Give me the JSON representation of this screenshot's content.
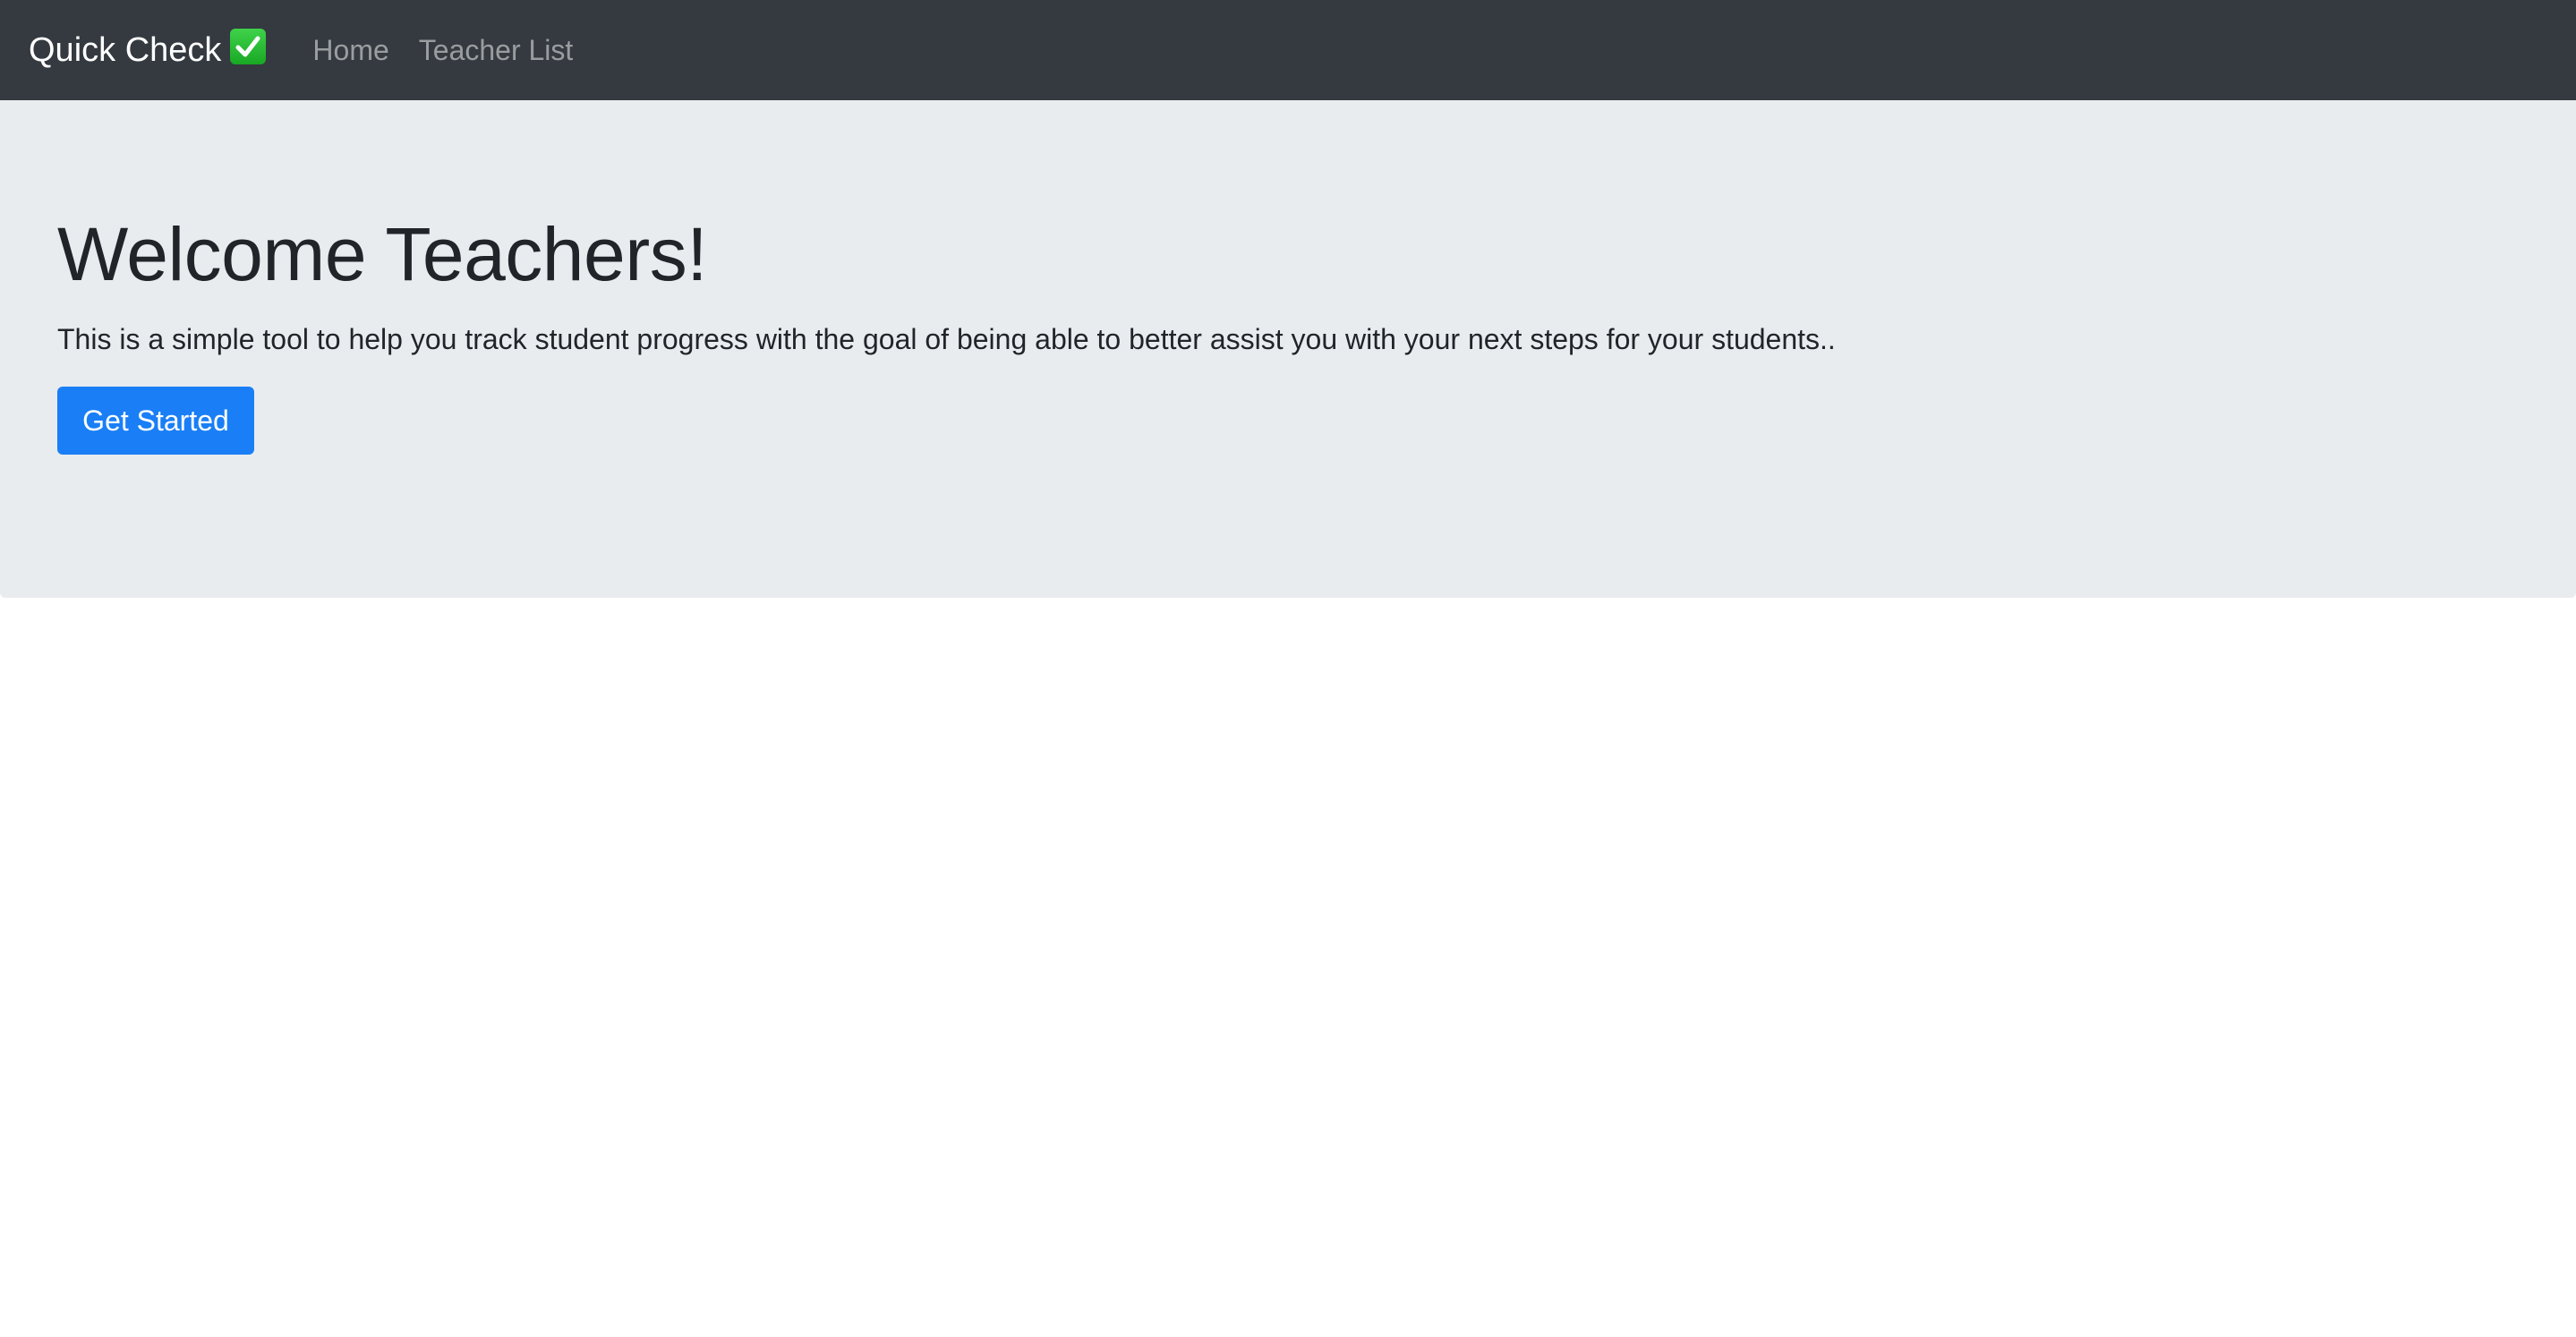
{
  "navbar": {
    "brand": "Quick Check",
    "brand_icon": "checkmark-box-icon",
    "links": [
      {
        "label": "Home"
      },
      {
        "label": "Teacher List"
      }
    ],
    "colors": {
      "background": "#343a40",
      "link": "rgba(255,255,255,0.5)"
    }
  },
  "hero": {
    "title": "Welcome Teachers!",
    "lead": "This is a simple tool to help you track student progress with the goal of being able to better assist you with your next steps for your students..",
    "cta_label": "Get Started",
    "colors": {
      "background": "#e9ecef",
      "button": "#1a7ff6"
    }
  }
}
